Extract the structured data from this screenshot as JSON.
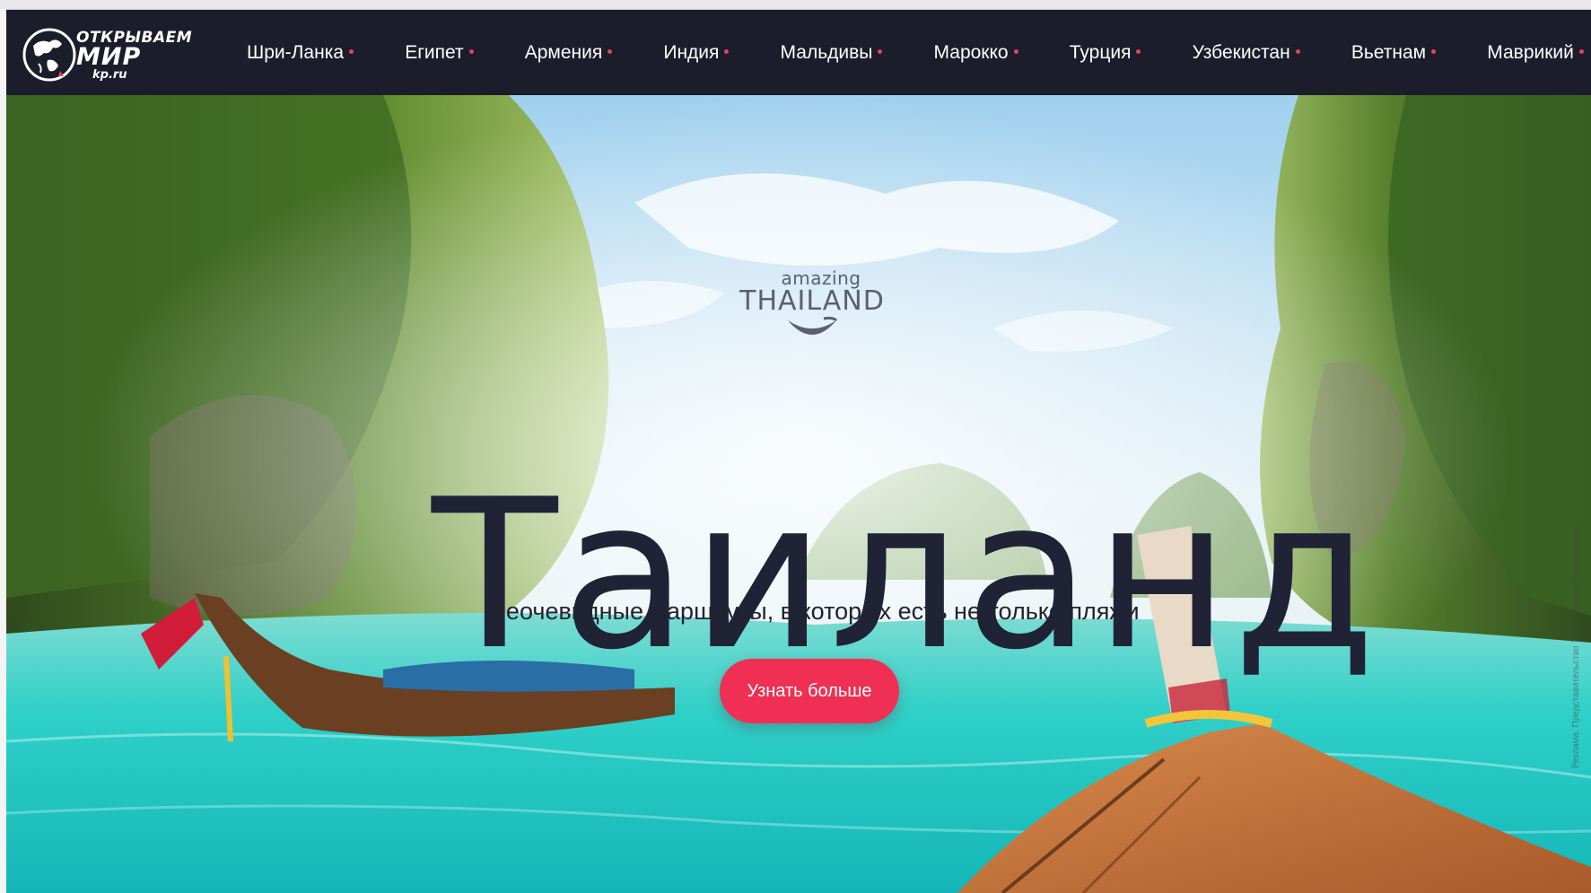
{
  "logo": {
    "line1": "ОТКРЫВАЕМ",
    "line2": "МИР",
    "line3": "kp.ru"
  },
  "nav": {
    "items": [
      {
        "label": "Шри-Ланка"
      },
      {
        "label": "Египет"
      },
      {
        "label": "Армения"
      },
      {
        "label": "Индия"
      },
      {
        "label": "Мальдивы"
      },
      {
        "label": "Марокко"
      },
      {
        "label": "Турция"
      },
      {
        "label": "Узбекистан"
      },
      {
        "label": "Вьетнам"
      },
      {
        "label": "Маврикий"
      }
    ],
    "dot_color": "#e8415b"
  },
  "hero": {
    "partner_logo": {
      "small": "amazing",
      "large": "THAILAND"
    },
    "title": "Таиланд",
    "subtitle": "Неочевидные маршруты, в которых есть не только пляжи",
    "cta_label": "Узнать больше",
    "ad_note": "Реклама. Представительство Туристического управления"
  },
  "colors": {
    "navbar_bg": "#1c1d2b",
    "cta_bg": "#ef2f53",
    "title_color": "#1f2335",
    "water": "#21c7c4"
  }
}
